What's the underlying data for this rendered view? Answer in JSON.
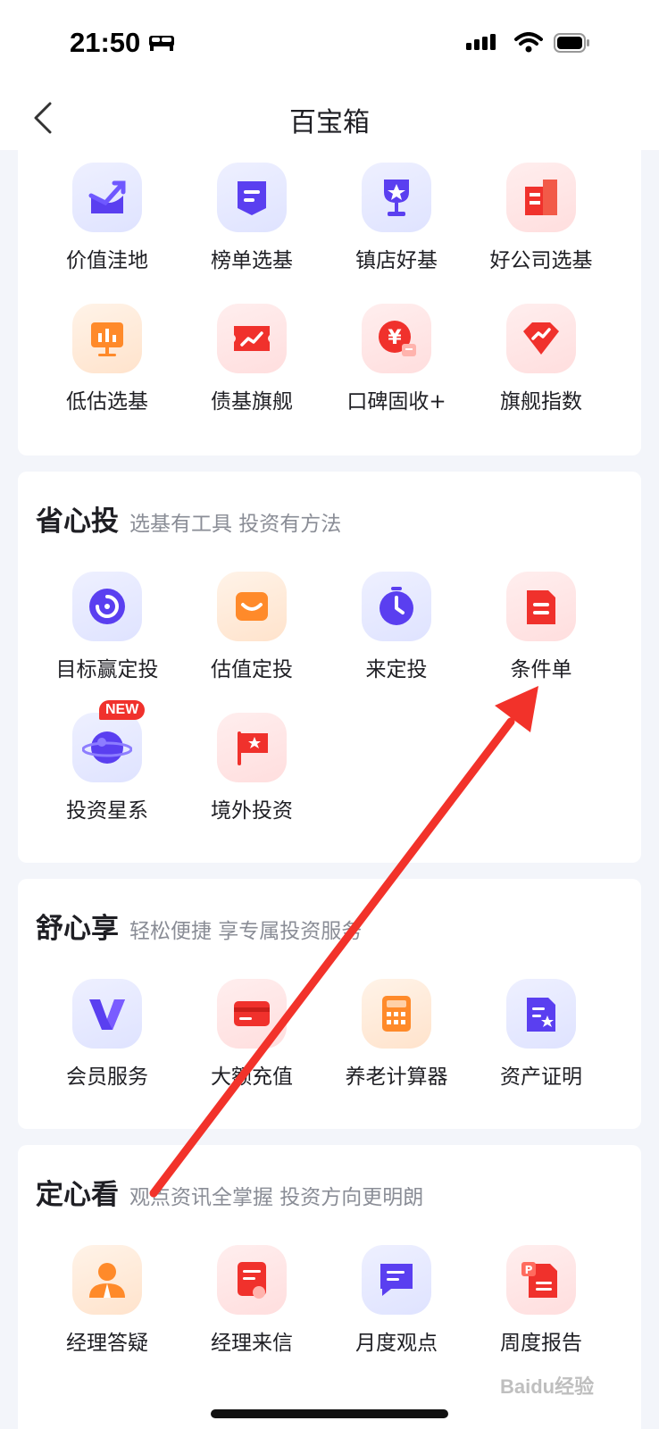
{
  "status_bar": {
    "time": "21:50"
  },
  "nav": {
    "title": "百宝箱"
  },
  "sections": {
    "top": {
      "items": [
        {
          "label": "价值洼地",
          "icon": "value-depression-icon"
        },
        {
          "label": "榜单选基",
          "icon": "ranking-list-icon"
        },
        {
          "label": "镇店好基",
          "icon": "trophy-icon"
        },
        {
          "label": "好公司选基",
          "icon": "company-building-icon"
        },
        {
          "label": "低估选基",
          "icon": "chart-board-icon"
        },
        {
          "label": "债基旗舰",
          "icon": "bond-ticket-icon"
        },
        {
          "label": "口碑固收+",
          "icon": "yuan-coin-icon"
        },
        {
          "label": "旗舰指数",
          "icon": "diamond-trend-icon"
        }
      ]
    },
    "invest": {
      "title": "省心投",
      "subtitle": "选基有工具 投资有方法",
      "items": [
        {
          "label": "目标赢定投",
          "icon": "target-ring-icon"
        },
        {
          "label": "估值定投",
          "icon": "smile-box-icon"
        },
        {
          "label": "来定投",
          "icon": "timer-icon"
        },
        {
          "label": "条件单",
          "icon": "document-icon"
        },
        {
          "label": "投资星系",
          "icon": "planet-icon",
          "badge": "NEW"
        },
        {
          "label": "境外投资",
          "icon": "flag-icon"
        }
      ]
    },
    "enjoy": {
      "title": "舒心享",
      "subtitle": "轻松便捷 享专属投资服务",
      "items": [
        {
          "label": "会员服务",
          "icon": "vip-v-icon"
        },
        {
          "label": "大额充值",
          "icon": "bank-card-icon"
        },
        {
          "label": "养老计算器",
          "icon": "calculator-icon"
        },
        {
          "label": "资产证明",
          "icon": "certificate-icon"
        }
      ]
    },
    "watch": {
      "title": "定心看",
      "subtitle": "观点资讯全掌握 投资方向更明朗",
      "items": [
        {
          "label": "经理答疑",
          "icon": "manager-avatar-icon"
        },
        {
          "label": "经理来信",
          "icon": "letter-icon"
        },
        {
          "label": "月度观点",
          "icon": "chat-bubble-icon"
        },
        {
          "label": "周度报告",
          "icon": "ppt-report-icon"
        }
      ]
    }
  },
  "watermark": "Baidu经验",
  "colors": {
    "accent_red": "#f0312c",
    "accent_blue": "#5a3ff0",
    "accent_orange": "#ff8a2a",
    "annotation_arrow": "#f2322a"
  }
}
